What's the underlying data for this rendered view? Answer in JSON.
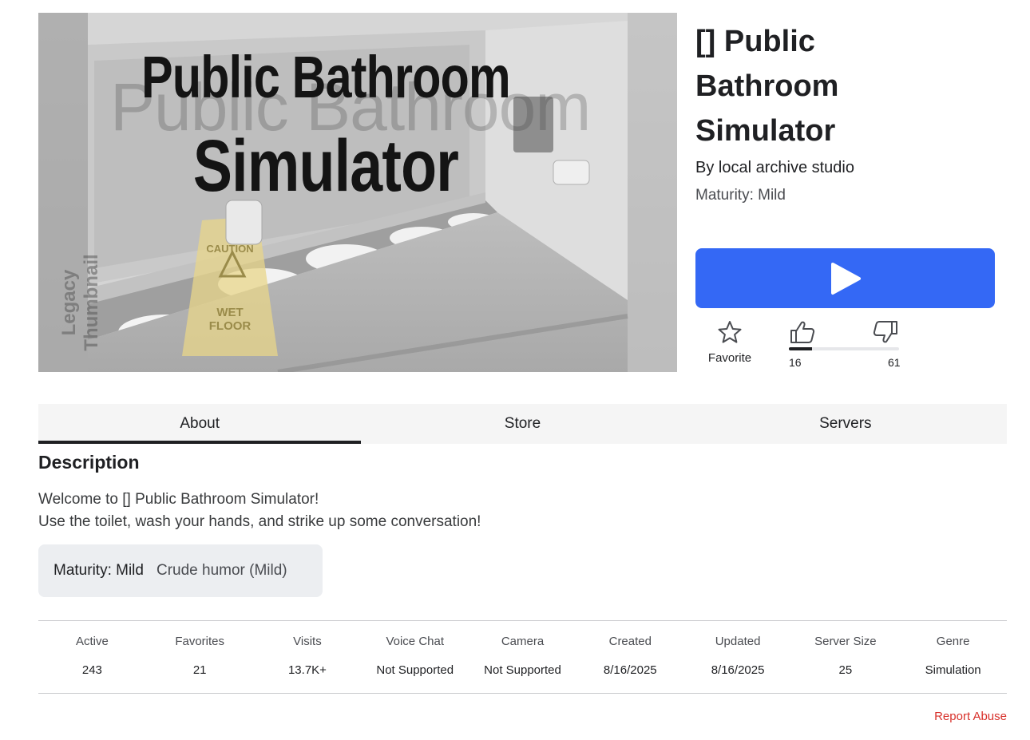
{
  "thumbnail": {
    "title_line1": "Public Bathroom",
    "title_line2": "Simulator",
    "ghost_text": "Public Bathroom",
    "watermark": "Legacy Thumbnail"
  },
  "game": {
    "title": "[] Public Bathroom Simulator",
    "by_prefix": "By ",
    "creator": "local archive studio",
    "maturity_line": "Maturity: Mild"
  },
  "actions": {
    "play_icon": "play-icon",
    "favorite_label": "Favorite",
    "upvotes": "16",
    "downvotes": "61",
    "upvote_ratio": 0.2078
  },
  "tabs": [
    {
      "label": "About",
      "active": true
    },
    {
      "label": "Store",
      "active": false
    },
    {
      "label": "Servers",
      "active": false
    }
  ],
  "description": {
    "heading": "Description",
    "line1": "Welcome to [] Public Bathroom Simulator!",
    "line2": "Use the toilet, wash your hands, and strike up some conversation!",
    "maturity_label": "Maturity: Mild",
    "maturity_detail": "Crude humor (Mild)"
  },
  "stats": [
    {
      "label": "Active",
      "value": "243"
    },
    {
      "label": "Favorites",
      "value": "21"
    },
    {
      "label": "Visits",
      "value": "13.7K+"
    },
    {
      "label": "Voice Chat",
      "value": "Not Supported"
    },
    {
      "label": "Camera",
      "value": "Not Supported"
    },
    {
      "label": "Created",
      "value": "8/16/2025"
    },
    {
      "label": "Updated",
      "value": "8/16/2025"
    },
    {
      "label": "Server Size",
      "value": "25"
    },
    {
      "label": "Genre",
      "value": "Simulation"
    }
  ],
  "report_label": "Report Abuse",
  "colors": {
    "play_button": "#3468f5",
    "report": "#d8312b",
    "text": "#1f2023"
  }
}
